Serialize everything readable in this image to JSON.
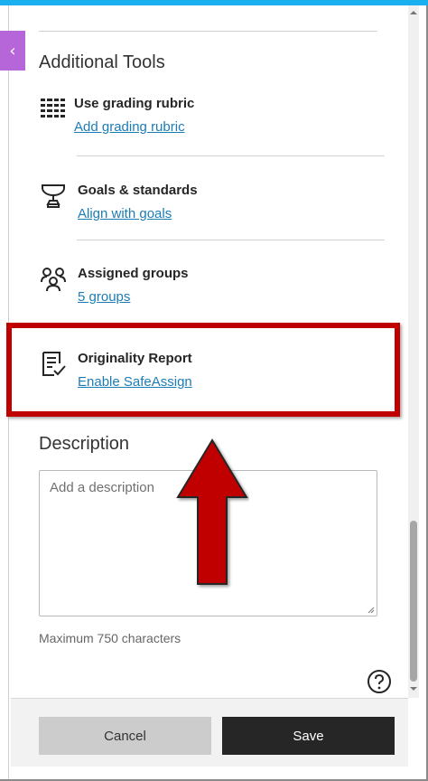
{
  "collapse_tab": {
    "icon": "chevron-left-icon",
    "glyph": "‹"
  },
  "additional_tools": {
    "title": "Additional Tools",
    "items": [
      {
        "icon": "rubric-grid-icon",
        "label": "Use grading rubric",
        "link": "Add grading rubric"
      },
      {
        "icon": "trophy-icon",
        "label": "Goals & standards",
        "link": "Align with goals"
      },
      {
        "icon": "groups-icon",
        "label": "Assigned groups",
        "link": "5 groups"
      },
      {
        "icon": "document-check-icon",
        "label": "Originality Report",
        "link": "Enable SafeAssign"
      }
    ]
  },
  "description": {
    "title": "Description",
    "placeholder": "Add a description",
    "value": "",
    "helper": "Maximum 750 characters"
  },
  "help": {
    "icon": "help-circle-icon"
  },
  "footer": {
    "cancel_label": "Cancel",
    "save_label": "Save"
  },
  "annotation": {
    "highlight_color": "#c00000",
    "arrow_icon": "red-arrow-up-icon"
  },
  "colors": {
    "accent_top": "#1ab0ef",
    "collapse_tab": "#b766d9",
    "link": "#1c7cb5",
    "save_button": "#262626",
    "cancel_button": "#cccccc"
  }
}
